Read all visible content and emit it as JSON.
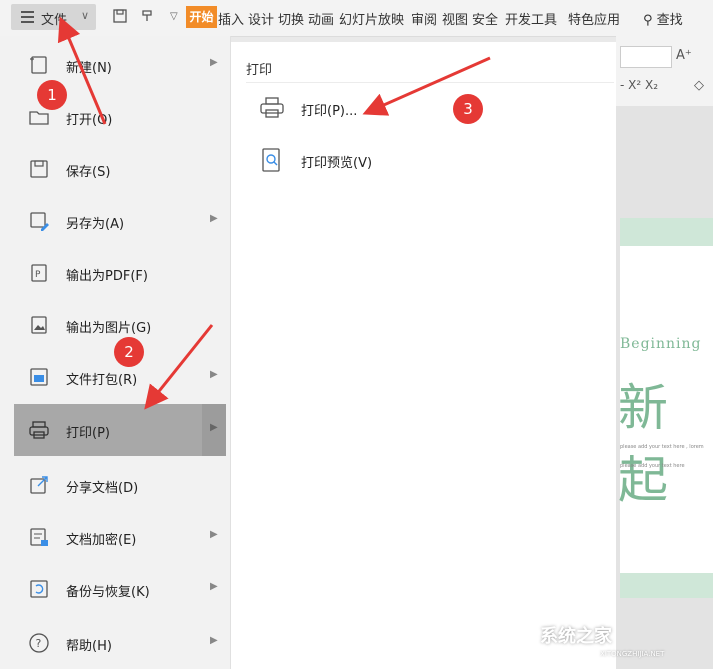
{
  "toolbar": {
    "file_label": "文件",
    "tabs": [
      "开始",
      "插入",
      "设计",
      "切换",
      "动画",
      "幻灯片放映",
      "审阅",
      "视图",
      "安全",
      "开发工具",
      "特色应用"
    ],
    "search_label": "查找"
  },
  "file_menu": {
    "items": [
      {
        "label": "新建(N)",
        "icon": "new-file-icon",
        "has_submenu": true
      },
      {
        "label": "打开(O)",
        "icon": "folder-open-icon",
        "has_submenu": false
      },
      {
        "label": "保存(S)",
        "icon": "save-icon",
        "has_submenu": false
      },
      {
        "label": "另存为(A)",
        "icon": "save-as-icon",
        "has_submenu": true
      },
      {
        "label": "输出为PDF(F)",
        "icon": "pdf-export-icon",
        "has_submenu": false
      },
      {
        "label": "输出为图片(G)",
        "icon": "image-export-icon",
        "has_submenu": false
      },
      {
        "label": "文件打包(R)",
        "icon": "package-icon",
        "has_submenu": true
      },
      {
        "label": "打印(P)",
        "icon": "printer-icon",
        "has_submenu": true,
        "selected": true
      },
      {
        "label": "分享文档(D)",
        "icon": "share-icon",
        "has_submenu": false
      },
      {
        "label": "文档加密(E)",
        "icon": "encrypt-icon",
        "has_submenu": true
      },
      {
        "label": "备份与恢复(K)",
        "icon": "backup-icon",
        "has_submenu": true
      },
      {
        "label": "帮助(H)",
        "icon": "help-icon",
        "has_submenu": true
      }
    ]
  },
  "print_submenu": {
    "title": "打印",
    "items": [
      {
        "label": "打印(P)...",
        "icon": "printer-icon"
      },
      {
        "label": "打印预览(V)",
        "icon": "print-preview-icon"
      }
    ]
  },
  "slide": {
    "beginning_text": "Beginning",
    "big_text": "新起",
    "line1": "please add your text here , lorem",
    "line2": "please add your text here"
  },
  "annotations": {
    "badge1": "1",
    "badge2": "2",
    "badge3": "3"
  },
  "watermark": {
    "text": "系统之家",
    "sub": "XITONGZHIJIA.NET"
  },
  "colors": {
    "accent": "#f28c28",
    "badge": "#e53935",
    "slide_green": "#7fb896",
    "selected_row": "#a8a8a8"
  }
}
